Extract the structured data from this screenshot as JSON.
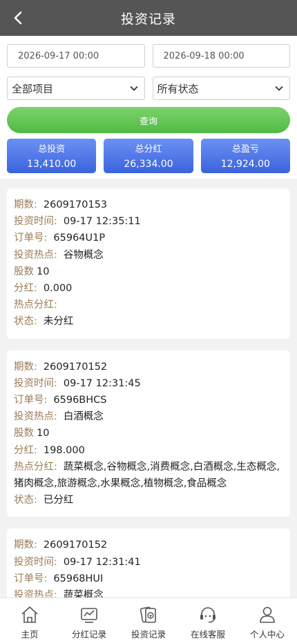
{
  "header": {
    "title": "投资记录"
  },
  "filters": {
    "start_date": "2026-09-17 00:00",
    "end_date": "2026-09-18 00:00",
    "project_select": "全部项目",
    "status_select": "所有状态",
    "query_label": "查询"
  },
  "stats": [
    {
      "label": "总投资",
      "value": "13,410.00"
    },
    {
      "label": "总分红",
      "value": "26,334.00"
    },
    {
      "label": "总盈亏",
      "value": "12,924.00"
    }
  ],
  "labels": {
    "period": "期数:",
    "time": "投资时间:",
    "order": "订单号:",
    "topic": "投资热点:",
    "shares": "股数",
    "dividend": "分红:",
    "hot_dividend": "热点分红:",
    "status": "状态:"
  },
  "records": [
    {
      "period": "2609170153",
      "time": "09-17 12:35:11",
      "order": "65964U1P",
      "topic": "谷物概念",
      "shares": "10",
      "dividend": "0.000",
      "hot_dividend": "",
      "status": "未分红"
    },
    {
      "period": "2609170152",
      "time": "09-17 12:31:45",
      "order": "6596BHCS",
      "topic": "白酒概念",
      "shares": "10",
      "dividend": "198.000",
      "hot_dividend": "蔬菜概念,谷物概念,消费概念,白酒概念,生态概念,猪肉概念,旅游概念,水果概念,植物概念,食品概念",
      "status": "已分红"
    },
    {
      "period": "2609170152",
      "time": "09-17 12:31:41",
      "order": "65968HUI",
      "topic": "蔬菜概念"
    }
  ],
  "tabbar": [
    {
      "label": "主页",
      "icon": "home-icon"
    },
    {
      "label": "分红记录",
      "icon": "dividend-record-icon"
    },
    {
      "label": "投资记录",
      "icon": "investment-record-icon"
    },
    {
      "label": "在线客服",
      "icon": "customer-service-icon"
    },
    {
      "label": "个人中心",
      "icon": "profile-icon"
    }
  ],
  "colors": {
    "header_bg": "#555555",
    "query_green": "#5ec150",
    "stat_blue": "#4a74e8",
    "label_brown": "#9a7b5a",
    "status_unpaid": "#1a9a1a",
    "status_paid": "#d11919"
  }
}
